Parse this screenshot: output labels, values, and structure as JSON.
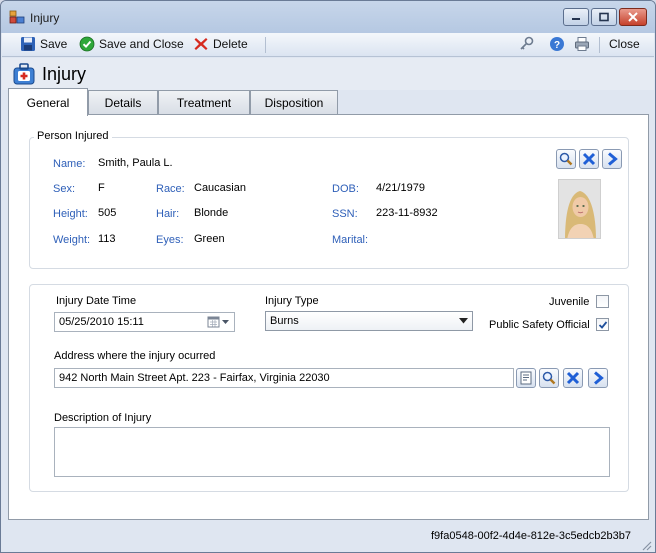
{
  "window": {
    "title": "Injury"
  },
  "toolbar": {
    "save": "Save",
    "save_close": "Save and Close",
    "delete": "Delete",
    "close": "Close"
  },
  "header": {
    "title": "Injury"
  },
  "tabs": [
    {
      "label": "General",
      "active": true
    },
    {
      "label": "Details"
    },
    {
      "label": "Treatment"
    },
    {
      "label": "Disposition"
    }
  ],
  "person": {
    "group_label": "Person Injured",
    "name_label": "Name:",
    "name": "Smith, Paula L.",
    "sex_label": "Sex:",
    "sex": "F",
    "race_label": "Race:",
    "race": "Caucasian",
    "dob_label": "DOB:",
    "dob": "4/21/1979",
    "height_label": "Height:",
    "height": "505",
    "hair_label": "Hair:",
    "hair": "Blonde",
    "ssn_label": "SSN:",
    "ssn": "223-11-8932",
    "weight_label": "Weight:",
    "weight": "113",
    "eyes_label": "Eyes:",
    "eyes": "Green",
    "marital_label": "Marital:"
  },
  "injury": {
    "datetime_label": "Injury Date Time",
    "datetime_value": "05/25/2010 15:11",
    "type_label": "Injury Type",
    "type_value": "Burns",
    "juvenile_label": "Juvenile",
    "juvenile_checked": false,
    "pso_label": "Public Safety Official",
    "pso_checked": true,
    "address_label": "Address where the injury ocurred",
    "address_value": "942 North Main Street Apt. 223 - Fairfax, Virginia 22030",
    "description_label": "Description of Injury",
    "description_value": ""
  },
  "status": {
    "id": "f9fa0548-00f2-4d4e-812e-3c5edcb2b3b7"
  },
  "colors": {
    "label_blue": "#2e5fb8",
    "accent_blue": "#1f5fd6",
    "delete_red": "#d62a1f",
    "check_green": "#2fa83a"
  }
}
